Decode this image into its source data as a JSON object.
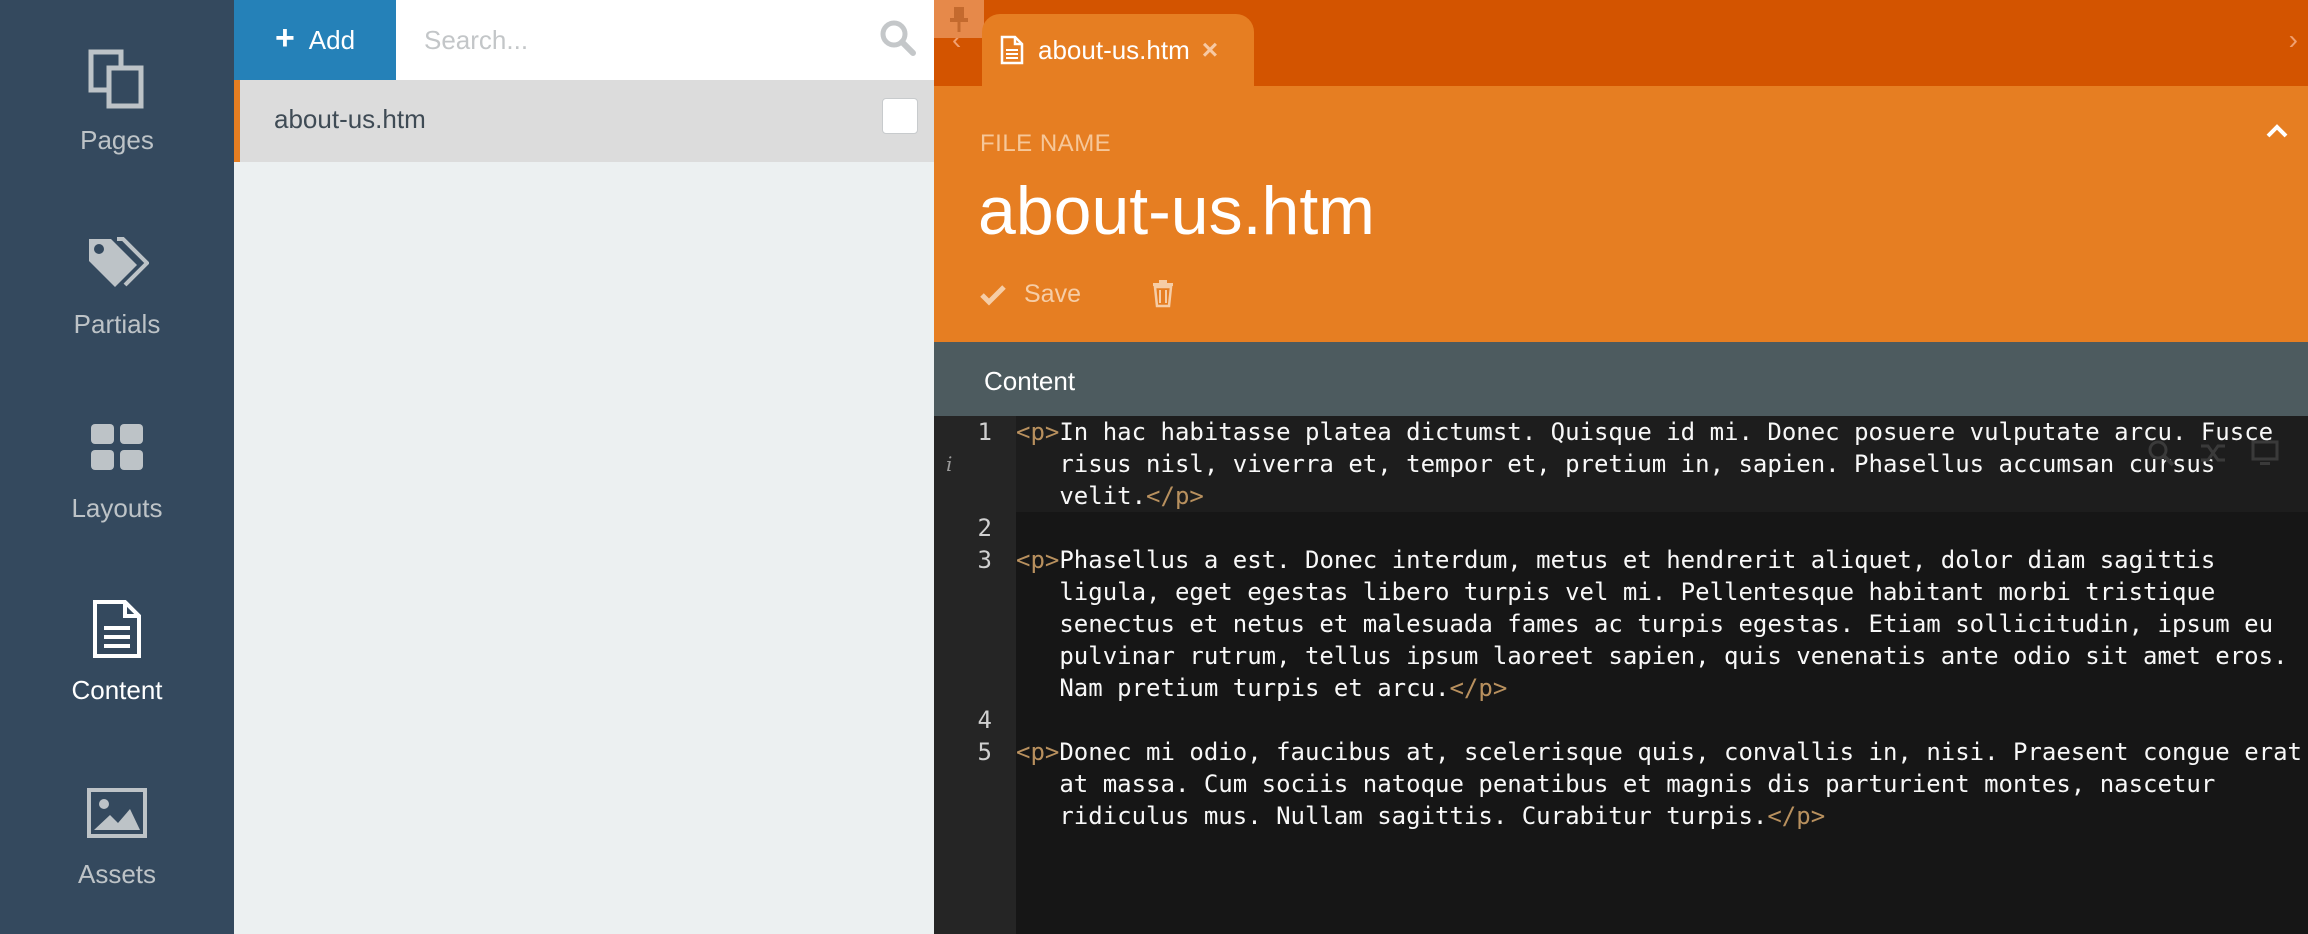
{
  "nav": {
    "items": [
      {
        "label": "Pages",
        "icon": "pages-icon"
      },
      {
        "label": "Partials",
        "icon": "tags-icon"
      },
      {
        "label": "Layouts",
        "icon": "layouts-icon"
      },
      {
        "label": "Content",
        "icon": "content-icon",
        "active": true
      },
      {
        "label": "Assets",
        "icon": "image-icon"
      }
    ]
  },
  "list": {
    "add_label": "Add",
    "search_placeholder": "Search...",
    "items": [
      {
        "label": "about-us.htm",
        "selected": true
      }
    ]
  },
  "tabs": [
    {
      "label": "about-us.htm",
      "icon": "file-icon",
      "close": "×"
    }
  ],
  "form": {
    "field_label": "FILE NAME",
    "file_name": "about-us.htm",
    "save_label": "Save"
  },
  "content": {
    "section_label": "Content",
    "line_numbers": [
      "1",
      "2",
      "3",
      "4",
      "5"
    ],
    "lines": [
      {
        "open": "<p>",
        "text": "In hac habitasse platea dictumst. Quisque id mi. Donec posuere vulputate arcu. Fusce",
        "close": ""
      },
      {
        "open": "",
        "text": "   risus nisl, viverra et, tempor et, pretium in, sapien. Phasellus accumsan cursus",
        "close": ""
      },
      {
        "open": "",
        "text": "   velit.",
        "close": "</p>"
      },
      {
        "open": "<p>",
        "text": "Phasellus a est. Donec interdum, metus et hendrerit aliquet, dolor diam sagittis",
        "close": ""
      },
      {
        "open": "",
        "text": "   ligula, eget egestas libero turpis vel mi. Pellentesque habitant morbi tristique",
        "close": ""
      },
      {
        "open": "",
        "text": "   senectus et netus et malesuada fames ac turpis egestas. Etiam sollicitudin, ipsum eu",
        "close": ""
      },
      {
        "open": "",
        "text": "   pulvinar rutrum, tellus ipsum laoreet sapien, quis venenatis ante odio sit amet eros.",
        "close": ""
      },
      {
        "open": "",
        "text": "   Nam pretium turpis et arcu.",
        "close": "</p>"
      },
      {
        "open": "<p>",
        "text": "Donec mi odio, faucibus at, scelerisque quis, convallis in, nisi. Praesent congue erat",
        "close": ""
      },
      {
        "open": "",
        "text": "   at massa. Cum sociis natoque penatibus et magnis dis parturient montes, nascetur",
        "close": ""
      },
      {
        "open": "",
        "text": "   ridiculus mus. Nullam sagittis. Curabitur turpis.",
        "close": "</p>"
      }
    ]
  },
  "colors": {
    "nav_bg": "#34495e",
    "accent_blue": "#2581b8",
    "tabbar": "#d35400",
    "accent_orange": "#e67e22",
    "content_header": "#4d5b5f",
    "code_bg": "#161616",
    "tag_color": "#b8905e"
  }
}
